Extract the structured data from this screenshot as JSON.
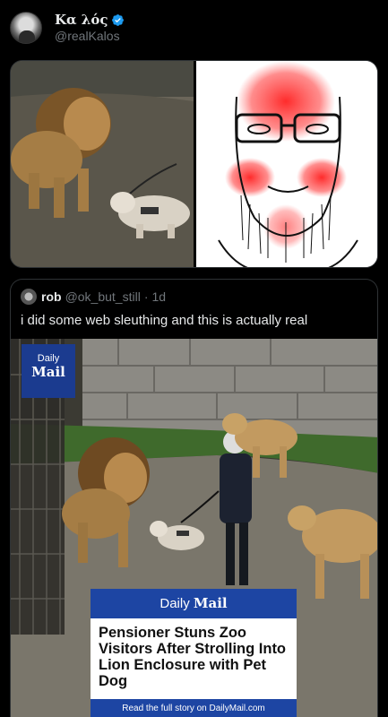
{
  "tweet": {
    "display_name": "Κα λός",
    "handle": "@realKalos",
    "verified_icon": "verified-badge-icon",
    "verified_color": "#1d9bf0"
  },
  "quote": {
    "name": "rob",
    "handle": "@ok_but_still",
    "dot": "·",
    "time": "1d",
    "text": "i did some web sleuthing and this is actually real"
  },
  "daily_mail": {
    "logo_line1": "Daily",
    "logo_line2": "Mail",
    "card_brand_light": "Daily",
    "card_brand_bold": "Mail",
    "headline": "Pensioner Stuns Zoo Visitors After Strolling Into Lion Enclosure with Pet Dog",
    "footer": "Read the full story on DailyMail.com",
    "brand_color": "#1d45a3"
  },
  "colors": {
    "background": "#000000",
    "text": "#e7e9ea",
    "muted": "#71767b",
    "border": "#2f3336"
  }
}
